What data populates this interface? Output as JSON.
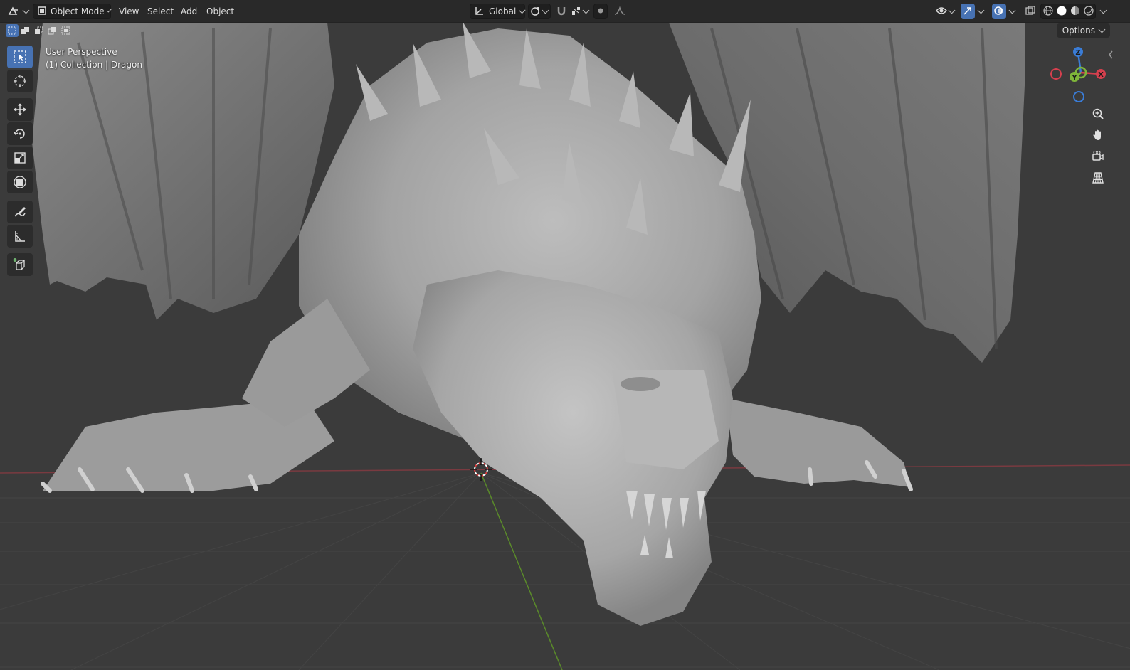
{
  "header": {
    "mode_label": "Object Mode",
    "menus": [
      "View",
      "Select",
      "Add",
      "Object"
    ],
    "transform_orientation": "Global",
    "accent_color": "#4772b3"
  },
  "options_label": "Options",
  "viewport": {
    "perspective": "User Perspective",
    "collection": "(1) Collection | Dragon"
  },
  "gizmo": {
    "z_label": "Z",
    "x_label": "X",
    "y_label": "Y",
    "colors": {
      "x": "#d6404e",
      "y": "#7fb63a",
      "z": "#3a7cd6"
    }
  },
  "tools": [
    "select-box-icon",
    "cursor-icon",
    "move-icon",
    "rotate-icon",
    "scale-icon",
    "transform-icon",
    "annotate-icon",
    "measure-icon",
    "add-cube-icon"
  ],
  "nav_buttons": [
    "zoom-icon",
    "pan-hand-icon",
    "camera-icon",
    "grid-view-icon"
  ]
}
